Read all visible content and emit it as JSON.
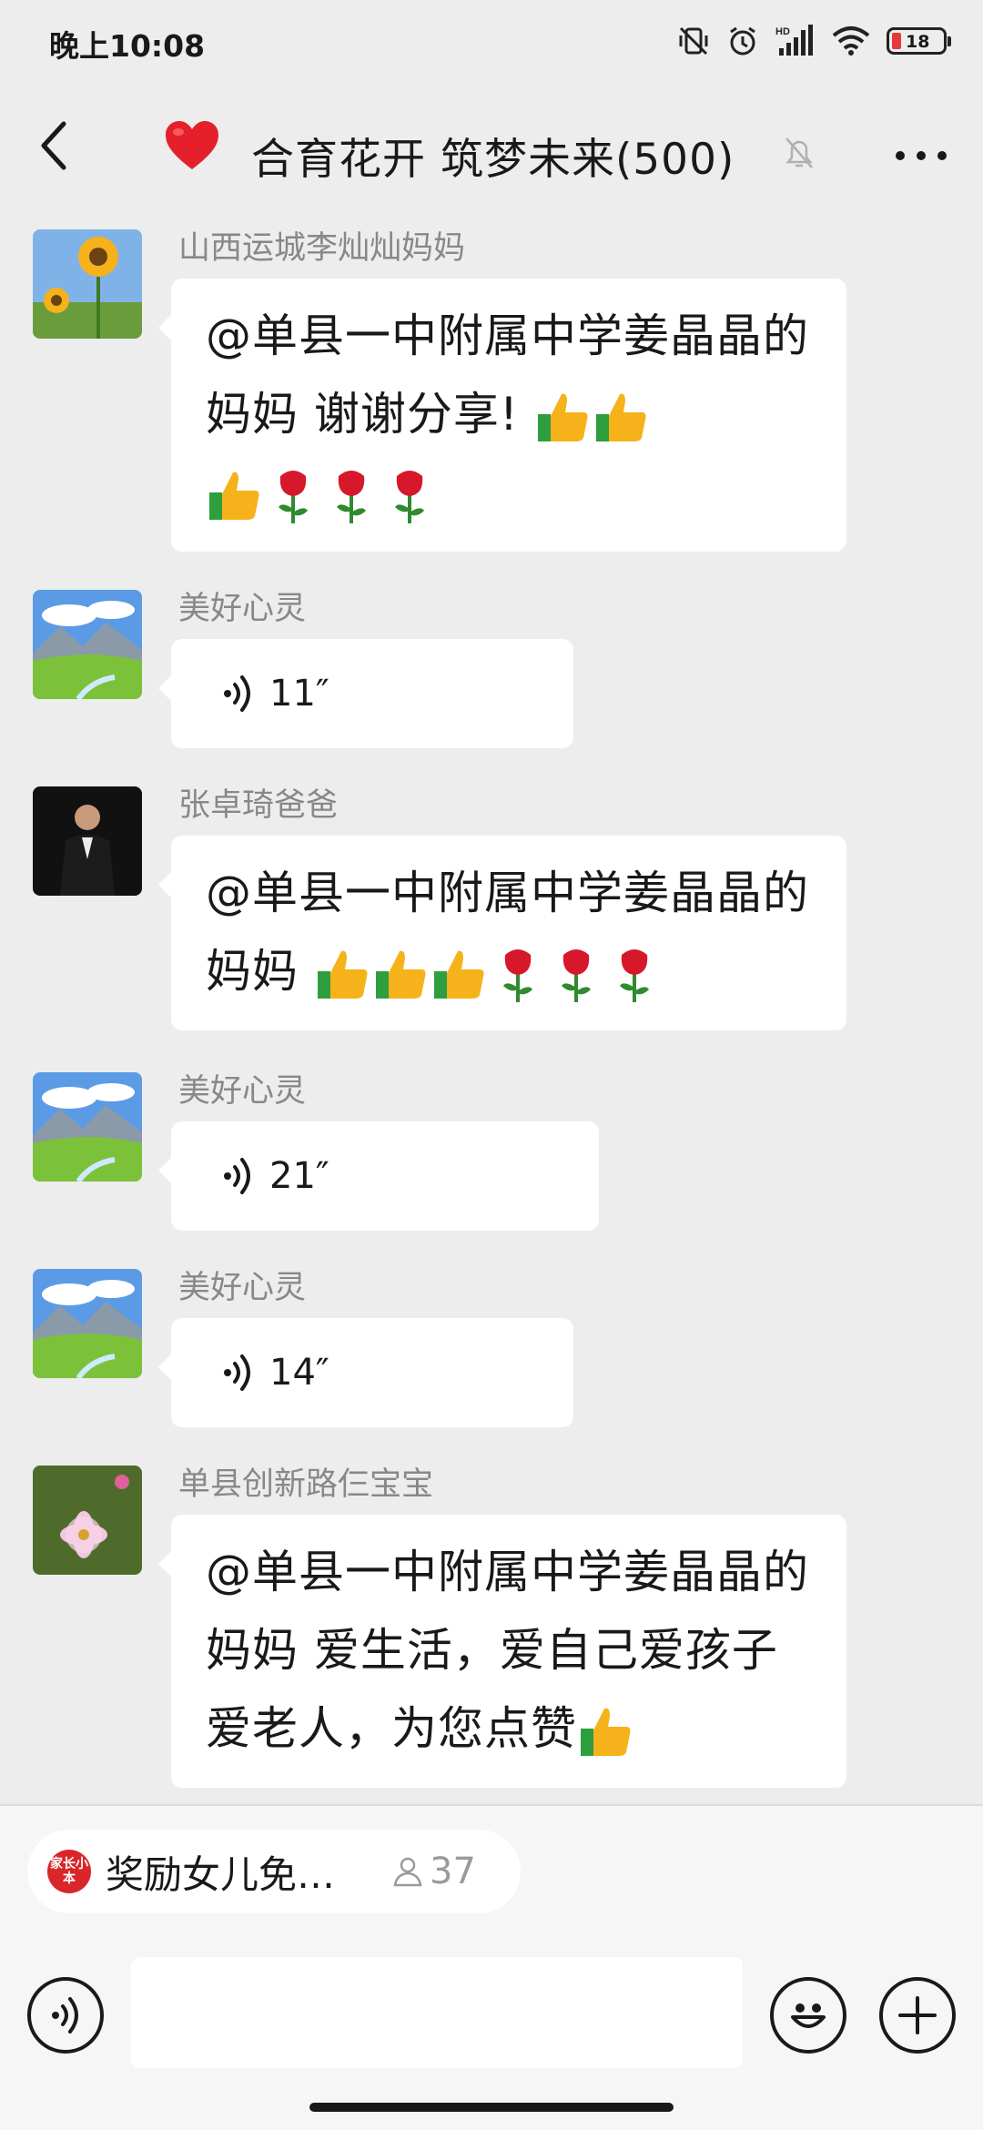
{
  "status_bar": {
    "time": "晚上10:08",
    "battery_level": "18",
    "network_label": "HD"
  },
  "nav": {
    "title": "合育花开 筑梦未来(500)"
  },
  "messages": [
    {
      "sender": "山西运城李灿灿妈妈",
      "type": "text",
      "text_parts": [
        "@单县一中附属中学姜晶晶的妈妈  谢谢分享! "
      ],
      "emojis": [
        "thumbs-up",
        "thumbs-up",
        "thumbs-up",
        "rose",
        "rose",
        "rose"
      ]
    },
    {
      "sender": "美好心灵",
      "type": "voice",
      "duration": "11″"
    },
    {
      "sender": "张卓琦爸爸",
      "type": "text",
      "text_parts": [
        "@单县一中附属中学姜晶晶的妈妈  "
      ],
      "emojis": [
        "thumbs-up",
        "thumbs-up",
        "thumbs-up",
        "rose",
        "rose",
        "rose"
      ]
    },
    {
      "sender": "美好心灵",
      "type": "voice",
      "duration": "21″"
    },
    {
      "sender": "美好心灵",
      "type": "voice",
      "duration": "14″"
    },
    {
      "sender": "单县创新路仨宝宝",
      "type": "text",
      "text_parts": [
        "@单县一中附属中学姜晶晶的妈妈  爱生活，爱自己爱孩子爱老人，为您点赞"
      ],
      "emojis": [
        "thumbs-up"
      ]
    }
  ],
  "notice": {
    "logo_text": "家长小本",
    "title": "奖励女儿免…",
    "count": "37"
  },
  "icons": {
    "back": "chevron-left-icon",
    "group_emoji": "red-heart-icon",
    "mute": "bell-mute-icon",
    "more": "more-dots-icon",
    "voice_toggle": "voice-icon",
    "emoji": "smiley-icon",
    "plus": "plus-icon"
  },
  "colors": {
    "background": "#ededed",
    "bubble": "#ffffff",
    "sender_text": "#888888",
    "heart": "#e5202b",
    "notice_logo": "#d8262b"
  }
}
